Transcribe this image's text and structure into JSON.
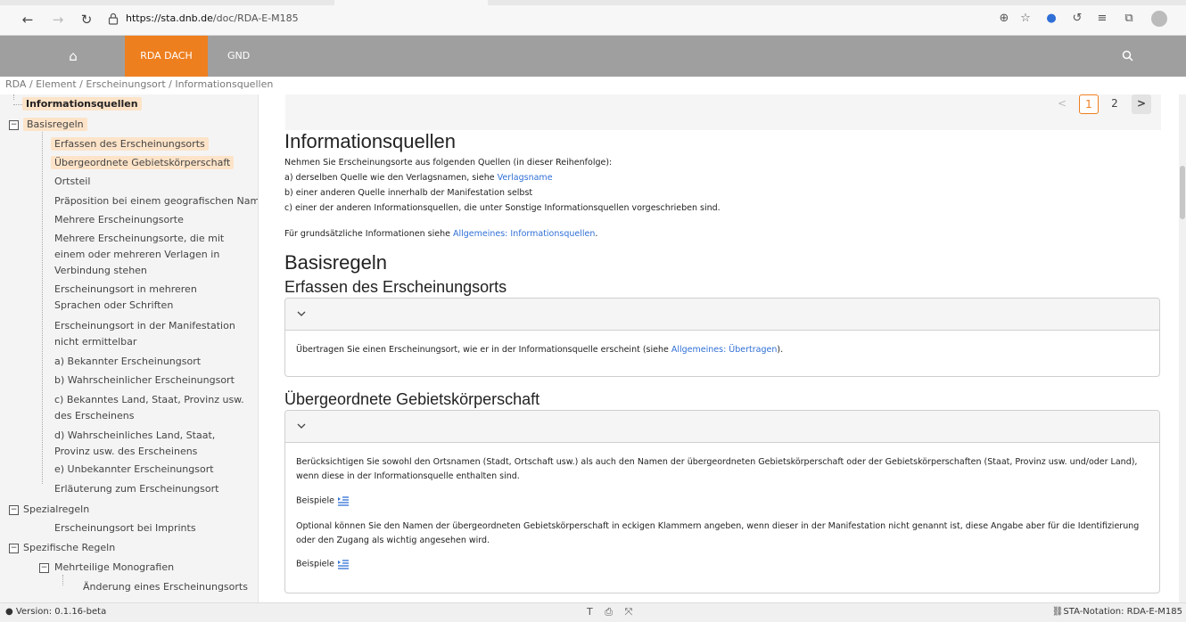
{
  "browser": {
    "url_domain": "https://sta.dnb.de",
    "url_path": "/doc/RDA-E-M185"
  },
  "header": {
    "nav_rda": "RDA DACH",
    "nav_gnd": "GND"
  },
  "breadcrumb": "RDA / Element / Erscheinungsort / Informationsquellen",
  "sidebar": {
    "items": [
      "Informationsquellen",
      "Basisregeln",
      "Erfassen des Erscheinungsorts",
      "Übergeordnete Gebietskörperschaft",
      "Ortsteil",
      "Präposition bei einem geografischen Namen",
      "Mehrere Erscheinungsorte",
      "Mehrere Erscheinungsorte, die mit einem oder mehreren Verlagen in Verbindung stehen",
      "Erscheinungsort in mehreren Sprachen oder Schriften",
      "Erscheinungsort in der Manifestation nicht ermittelbar",
      "a) Bekannter Erscheinungsort",
      "b) Wahrscheinlicher Erscheinungsort",
      "c) Bekanntes Land, Staat, Provinz usw. des Erscheinens",
      "d) Wahrscheinliches Land, Staat, Provinz usw. des Erscheinens",
      "e) Unbekannter Erscheinungsort",
      "Erläuterung zum Erscheinungsort",
      "Spezialregeln",
      "Erscheinungsort bei Imprints",
      "Spezifische Regeln",
      "Mehrteilige Monografien",
      "Änderung eines Erscheinungsorts"
    ]
  },
  "pager": {
    "prev": "<",
    "page1": "1",
    "page2": "2",
    "next": ">"
  },
  "content": {
    "title": "Informationsquellen",
    "intro": "Nehmen Sie Erscheinungsorte aus folgenden Quellen (in dieser Reihenfolge):",
    "line_a_pre": "a) derselben Quelle wie den Verlagsnamen, siehe ",
    "line_a_link": "Verlagsname",
    "line_b": "b) einer anderen Quelle innerhalb der Manifestation selbst",
    "line_c": "c) einer der anderen Informationsquellen, die unter Sonstige Informationsquellen vorgeschrieben sind.",
    "general_pre": "Für grundsätzliche Informationen siehe ",
    "general_link": "Allgemeines: Informationsquellen",
    "general_post": ".",
    "basisregeln": "Basisregeln",
    "erfassen_title": "Erfassen des Erscheinungsorts",
    "erfassen_pre": "Übertragen Sie einen Erscheinungsort, wie er in der Informationsquelle erscheint (siehe ",
    "erfassen_link": "Allgemeines: Übertragen",
    "erfassen_post": ").",
    "ueber_title": "Übergeordnete Gebietskörperschaft",
    "ueber_text1": "Berücksichtigen Sie sowohl den Ortsnamen (Stadt, Ortschaft usw.) als auch den Namen der übergeordneten Gebietskörperschaft oder der Gebietskörperschaften (Staat, Provinz usw. und/oder Land), wenn diese in der Informationsquelle enthalten sind.",
    "beispiele": "Beispiele",
    "ueber_text2": "Optional können Sie den Namen der übergeordneten Gebietskörperschaft in eckigen Klammern angeben, wenn dieser in der Manifestation nicht genannt ist, diese Angabe aber für die Identifizierung oder den Zugang als wichtig angesehen wird."
  },
  "status": {
    "version": "Version: 0.1.16-beta",
    "notation": "STA-Notation: RDA-E-M185"
  },
  "colors": {
    "accent": "#ee7f1f",
    "link": "#2f6fd6",
    "header_bg": "#9f9f9f"
  }
}
